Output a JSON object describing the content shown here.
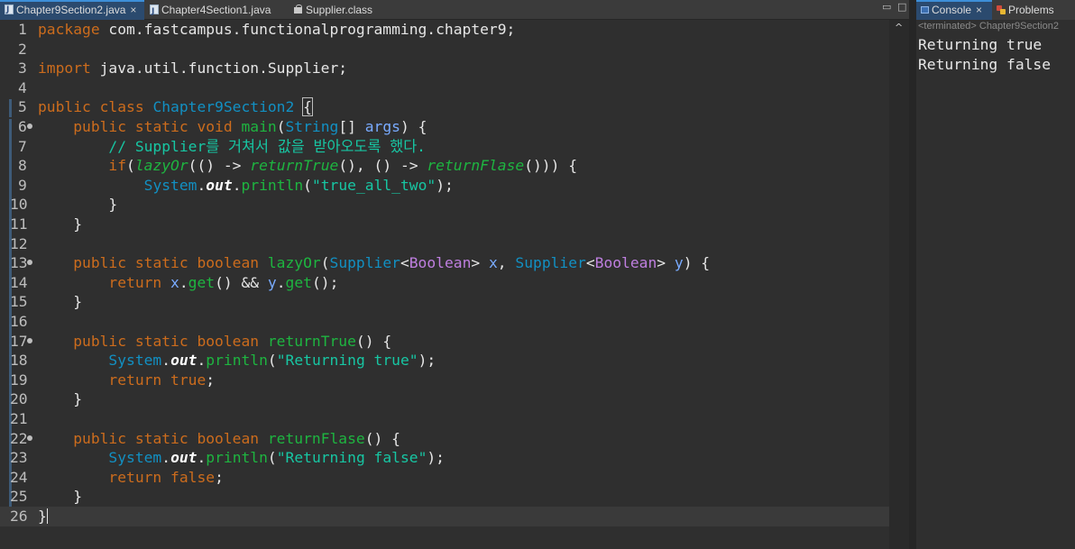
{
  "editor": {
    "tabs": [
      {
        "label": "Chapter9Section2.java",
        "active": true,
        "close": "×"
      },
      {
        "label": "Chapter4Section1.java",
        "active": false
      },
      {
        "label": "Supplier.class",
        "active": false
      }
    ],
    "window_controls": [
      "▭",
      "□"
    ],
    "scroll_arrow": "^",
    "lines": [
      {
        "n": "1",
        "parts": [
          [
            "kw",
            "package"
          ],
          [
            "pl",
            " com.fastcampus.functionalprogramming.chapter9;"
          ]
        ]
      },
      {
        "n": "2",
        "parts": []
      },
      {
        "n": "3",
        "parts": [
          [
            "kw",
            "import"
          ],
          [
            "pl",
            " java.util.function.Supplier;"
          ]
        ]
      },
      {
        "n": "4",
        "parts": []
      },
      {
        "n": "5",
        "parts": [
          [
            "kw",
            "public class "
          ],
          [
            "cls",
            "Chapter9Section2"
          ],
          [
            "pl",
            " "
          ],
          [
            "box",
            "{"
          ]
        ]
      },
      {
        "n": "6",
        "fold": true,
        "parts": [
          [
            "pl",
            "    "
          ],
          [
            "kw",
            "public static void "
          ],
          [
            "fn",
            "main"
          ],
          [
            "pl",
            "("
          ],
          [
            "cls",
            "String"
          ],
          [
            "pl",
            "[] "
          ],
          [
            "param",
            "args"
          ],
          [
            "pl",
            ") {"
          ]
        ]
      },
      {
        "n": "7",
        "parts": [
          [
            "pl",
            "        "
          ],
          [
            "cm",
            "// Supplier를 거쳐서 값을 받아오도록 했다."
          ]
        ]
      },
      {
        "n": "8",
        "parts": [
          [
            "pl",
            "        "
          ],
          [
            "kw",
            "if"
          ],
          [
            "pl",
            "("
          ],
          [
            "itfn",
            "lazyOr"
          ],
          [
            "pl",
            "(() -> "
          ],
          [
            "itfn",
            "returnTrue"
          ],
          [
            "pl",
            "(), () -> "
          ],
          [
            "itfn",
            "returnFlase"
          ],
          [
            "pl",
            "())) {"
          ]
        ]
      },
      {
        "n": "9",
        "parts": [
          [
            "pl",
            "            "
          ],
          [
            "sys",
            "System"
          ],
          [
            "pl",
            "."
          ],
          [
            "bi",
            "out"
          ],
          [
            "pl",
            "."
          ],
          [
            "fn",
            "println"
          ],
          [
            "pl",
            "("
          ],
          [
            "str",
            "\"true_all_two\""
          ],
          [
            "pl",
            ");"
          ]
        ]
      },
      {
        "n": "10",
        "parts": [
          [
            "pl",
            "        }"
          ]
        ]
      },
      {
        "n": "11",
        "parts": [
          [
            "pl",
            "    }"
          ]
        ]
      },
      {
        "n": "12",
        "parts": []
      },
      {
        "n": "13",
        "fold": true,
        "parts": [
          [
            "pl",
            "    "
          ],
          [
            "kw",
            "public static boolean "
          ],
          [
            "fn",
            "lazyOr"
          ],
          [
            "pl",
            "("
          ],
          [
            "cls",
            "Supplier"
          ],
          [
            "pl",
            "<"
          ],
          [
            "gen",
            "Boolean"
          ],
          [
            "pl",
            "> "
          ],
          [
            "param",
            "x"
          ],
          [
            "pl",
            ", "
          ],
          [
            "cls",
            "Supplier"
          ],
          [
            "pl",
            "<"
          ],
          [
            "gen",
            "Boolean"
          ],
          [
            "pl",
            "> "
          ],
          [
            "param",
            "y"
          ],
          [
            "pl",
            ") {"
          ]
        ]
      },
      {
        "n": "14",
        "parts": [
          [
            "pl",
            "        "
          ],
          [
            "kw",
            "return "
          ],
          [
            "param",
            "x"
          ],
          [
            "pl",
            "."
          ],
          [
            "fn",
            "get"
          ],
          [
            "pl",
            "() && "
          ],
          [
            "param",
            "y"
          ],
          [
            "pl",
            "."
          ],
          [
            "fn",
            "get"
          ],
          [
            "pl",
            "();"
          ]
        ]
      },
      {
        "n": "15",
        "parts": [
          [
            "pl",
            "    }"
          ]
        ]
      },
      {
        "n": "16",
        "parts": []
      },
      {
        "n": "17",
        "fold": true,
        "parts": [
          [
            "pl",
            "    "
          ],
          [
            "kw",
            "public static boolean "
          ],
          [
            "fn",
            "returnTrue"
          ],
          [
            "pl",
            "() {"
          ]
        ]
      },
      {
        "n": "18",
        "parts": [
          [
            "pl",
            "        "
          ],
          [
            "sys",
            "System"
          ],
          [
            "pl",
            "."
          ],
          [
            "bi",
            "out"
          ],
          [
            "pl",
            "."
          ],
          [
            "fn",
            "println"
          ],
          [
            "pl",
            "("
          ],
          [
            "str",
            "\"Returning true\""
          ],
          [
            "pl",
            ");"
          ]
        ]
      },
      {
        "n": "19",
        "parts": [
          [
            "pl",
            "        "
          ],
          [
            "kw",
            "return true"
          ],
          [
            "pl",
            ";"
          ]
        ]
      },
      {
        "n": "20",
        "parts": [
          [
            "pl",
            "    }"
          ]
        ]
      },
      {
        "n": "21",
        "parts": []
      },
      {
        "n": "22",
        "fold": true,
        "parts": [
          [
            "pl",
            "    "
          ],
          [
            "kw",
            "public static boolean "
          ],
          [
            "fn",
            "returnFlase"
          ],
          [
            "pl",
            "() {"
          ]
        ]
      },
      {
        "n": "23",
        "parts": [
          [
            "pl",
            "        "
          ],
          [
            "sys",
            "System"
          ],
          [
            "pl",
            "."
          ],
          [
            "bi",
            "out"
          ],
          [
            "pl",
            "."
          ],
          [
            "fn",
            "println"
          ],
          [
            "pl",
            "("
          ],
          [
            "str",
            "\"Returning false\""
          ],
          [
            "pl",
            ");"
          ]
        ]
      },
      {
        "n": "24",
        "parts": [
          [
            "pl",
            "        "
          ],
          [
            "kw",
            "return false"
          ],
          [
            "pl",
            ";"
          ]
        ]
      },
      {
        "n": "25",
        "parts": [
          [
            "pl",
            "    }"
          ]
        ]
      },
      {
        "n": "26",
        "current": true,
        "parts": [
          [
            "pl",
            "}"
          ]
        ]
      }
    ]
  },
  "console": {
    "tabs": [
      {
        "label": "Console",
        "close": "×",
        "active": true
      },
      {
        "label": "Problems",
        "active": false
      }
    ],
    "status": "<terminated> Chapter9Section2",
    "output": [
      "Returning true",
      "Returning false"
    ]
  },
  "colors": {
    "keyword": "#cc6c1d",
    "class": "#1290c3",
    "method": "#1eb540",
    "comment": "#17c6a3",
    "string": "#17c6a3",
    "param": "#79abff",
    "generic": "#bf7fe0",
    "background": "#2f2f2f"
  }
}
